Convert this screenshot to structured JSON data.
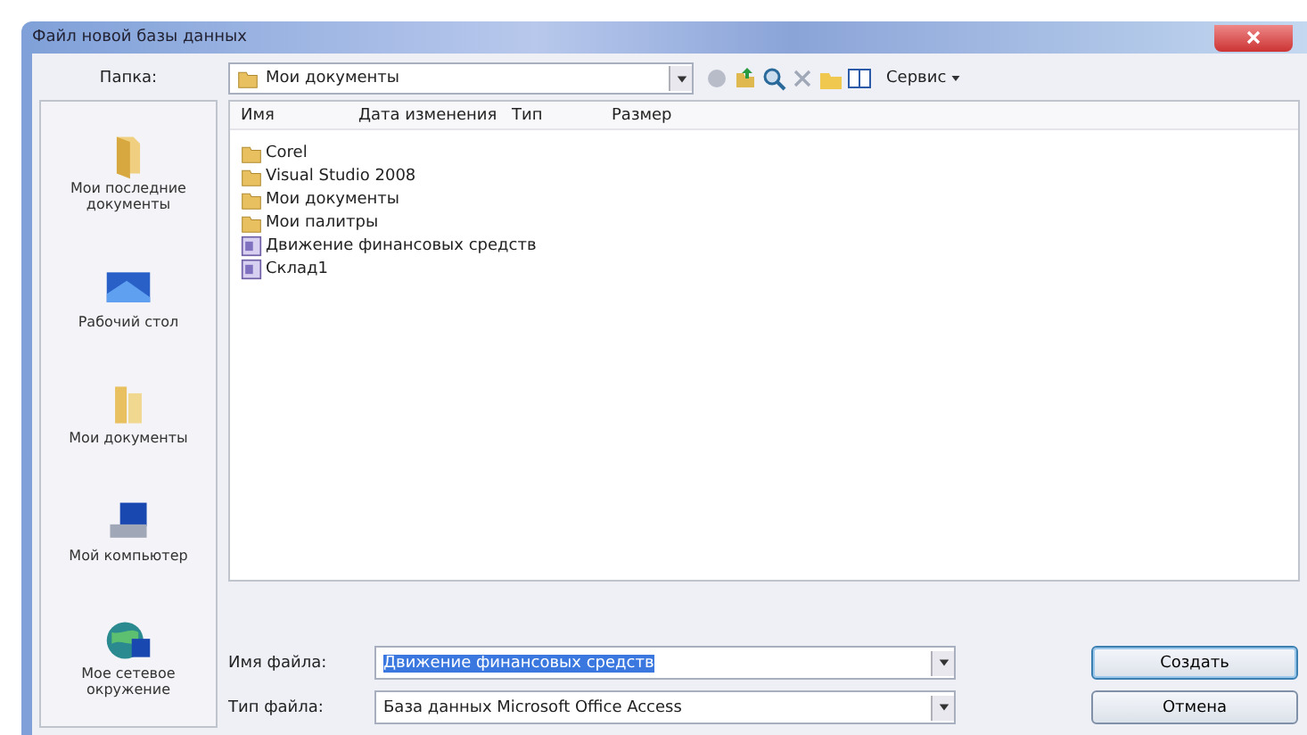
{
  "window": {
    "title": "Файл новой базы данных"
  },
  "toolbar": {
    "folder_label": "Папка:",
    "folder": "Мои документы",
    "tools_label": "Сервис"
  },
  "places": [
    {
      "kind": "recent",
      "label": "Мои последние документы"
    },
    {
      "kind": "desktop",
      "label": "Рабочий стол"
    },
    {
      "kind": "documents",
      "label": "Мои документы"
    },
    {
      "kind": "computer",
      "label": "Мой компьютер"
    },
    {
      "kind": "network",
      "label": "Мое сетевое окружение"
    }
  ],
  "table": {
    "columns": [
      "Имя",
      "Дата изменения",
      "Тип",
      "Размер"
    ],
    "rows": [
      {
        "kind": "folder",
        "name": "Corel"
      },
      {
        "kind": "folder",
        "name": "Visual Studio 2008"
      },
      {
        "kind": "folder",
        "name": "Мои документы"
      },
      {
        "kind": "folder",
        "name": "Мои палитры"
      },
      {
        "kind": "database",
        "name": "Движение финансовых средств"
      },
      {
        "kind": "database",
        "name": "Склад1"
      }
    ]
  },
  "file_name": {
    "label": "Имя файла:",
    "value": "Движение финансовых средств"
  },
  "file_type": {
    "label": "Тип файла:",
    "value": "База данных Microsoft Office Access"
  },
  "buttons": [
    "Создать",
    "Отмена"
  ]
}
